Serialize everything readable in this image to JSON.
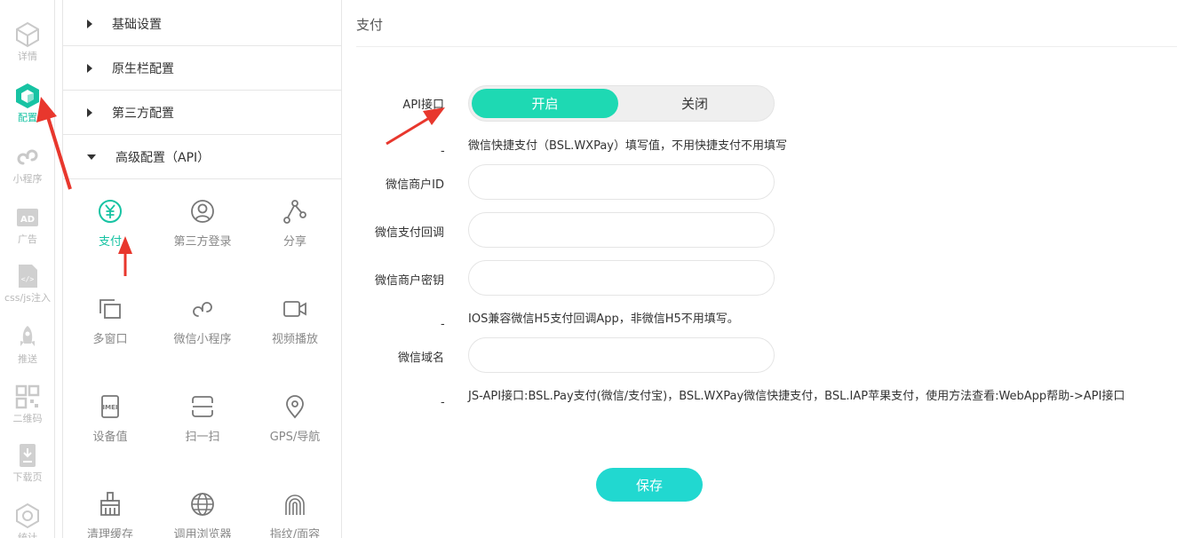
{
  "rail": {
    "items": [
      {
        "label": "详情",
        "icon": "cube-outline-icon"
      },
      {
        "label": "配置",
        "icon": "cube-filled-icon",
        "active": true
      },
      {
        "label": "小程序",
        "icon": "mini-program-icon"
      },
      {
        "label": "广告",
        "icon": "ad-icon"
      },
      {
        "label": "css/js注入",
        "icon": "code-file-icon"
      },
      {
        "label": "推送",
        "icon": "rocket-icon"
      },
      {
        "label": "二维码",
        "icon": "qr-code-icon"
      },
      {
        "label": "下载页",
        "icon": "download-page-icon"
      },
      {
        "label": "统计",
        "icon": "stats-icon"
      }
    ]
  },
  "panel": {
    "sections": [
      {
        "label": "基础设置",
        "expanded": false
      },
      {
        "label": "原生栏配置",
        "expanded": false
      },
      {
        "label": "第三方配置",
        "expanded": false
      },
      {
        "label": "高级配置（API）",
        "expanded": true
      }
    ],
    "grid": [
      {
        "label": "支付",
        "icon": "yuan-circle-icon",
        "active": true
      },
      {
        "label": "第三方登录",
        "icon": "user-circle-icon"
      },
      {
        "label": "分享",
        "icon": "share-icon"
      },
      {
        "label": "多窗口",
        "icon": "multi-window-icon"
      },
      {
        "label": "微信小程序",
        "icon": "mini-program-icon"
      },
      {
        "label": "视频播放",
        "icon": "video-icon"
      },
      {
        "label": "设备值",
        "icon": "imei-icon"
      },
      {
        "label": "扫一扫",
        "icon": "scan-icon"
      },
      {
        "label": "GPS/导航",
        "icon": "location-pin-icon"
      },
      {
        "label": "清理缓存",
        "icon": "broom-icon"
      },
      {
        "label": "调用浏览器",
        "icon": "globe-icon"
      },
      {
        "label": "指纹/面容",
        "icon": "fingerprint-icon"
      }
    ]
  },
  "main": {
    "title": "支付",
    "api_label": "API接口",
    "toggle": {
      "on": "开启",
      "off": "关闭",
      "selected": "开启"
    },
    "dash": "-",
    "hint1": "微信快捷支付（BSL.WXPay）填写值，不用快捷支付不用填写",
    "fields": [
      {
        "label": "微信商户ID",
        "value": ""
      },
      {
        "label": "微信支付回调",
        "value": ""
      },
      {
        "label": "微信商户密钥",
        "value": ""
      }
    ],
    "hint2": "IOS兼容微信H5支付回调App，非微信H5不用填写。",
    "domain_label": "微信域名",
    "domain_value": "",
    "hint3": "JS-API接口:BSL.Pay支付(微信/支付宝)，BSL.WXPay微信快捷支付，BSL.IAP苹果支付，使用方法查看:WebApp帮助->API接口",
    "save_label": "保存"
  },
  "colors": {
    "accent": "#17c3a3",
    "toggle_on": "#1ed9b3",
    "save_button": "#21d8d0",
    "annotation_arrow": "#e8372d"
  }
}
